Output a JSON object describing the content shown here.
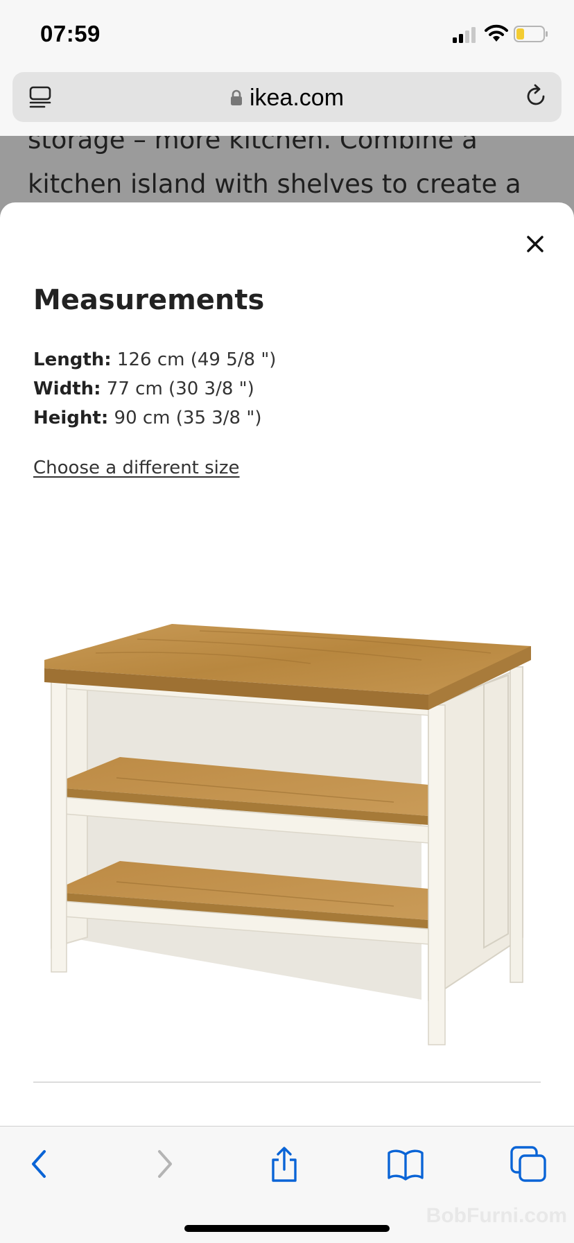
{
  "status_bar": {
    "time": "07:59"
  },
  "browser": {
    "url": "ikea.com",
    "toolbar": {
      "back": "back-icon",
      "forward": "forward-icon",
      "share": "share-icon",
      "bookmarks": "bookmarks-icon",
      "tabs": "tabs-icon"
    }
  },
  "background_page": {
    "line1": "storage – more kitchen. Combine a",
    "line2": "kitchen island with shelves to create a"
  },
  "modal": {
    "title": "Measurements",
    "measurements": [
      {
        "label": "Length:",
        "value": " 126 cm (49 5/8 \")"
      },
      {
        "label": "Width:",
        "value": " 77 cm (30 3/8 \")"
      },
      {
        "label": "Height:",
        "value": " 90 cm (35 3/8 \")"
      }
    ],
    "link": "Choose a different size"
  },
  "watermark": "BobFurni.com",
  "colors": {
    "wood": "#c49552",
    "frame": "#f4f1e8",
    "accent": "#0a64d6"
  }
}
